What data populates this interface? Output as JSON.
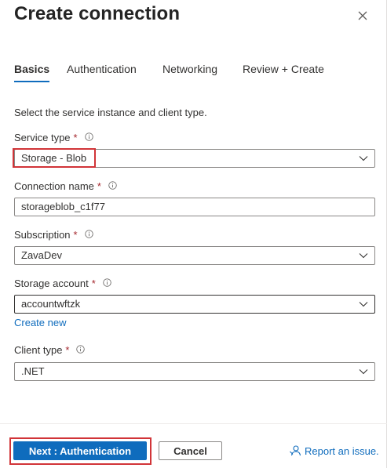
{
  "header": {
    "title": "Create connection"
  },
  "tabs": [
    {
      "label": "Basics",
      "active": true
    },
    {
      "label": "Authentication",
      "active": false
    },
    {
      "label": "Networking",
      "active": false
    },
    {
      "label": "Review + Create",
      "active": false
    }
  ],
  "intro": "Select the service instance and client type.",
  "form": {
    "service_type": {
      "label": "Service type",
      "required": "*",
      "value": "Storage - Blob"
    },
    "connection_name": {
      "label": "Connection name",
      "required": "*",
      "value": "storageblob_c1f77"
    },
    "subscription": {
      "label": "Subscription",
      "required": "*",
      "value": "ZavaDev"
    },
    "storage_account": {
      "label": "Storage account",
      "required": "*",
      "value": "accountwftzk",
      "create_new": "Create new"
    },
    "client_type": {
      "label": "Client type",
      "required": "*",
      "value": ".NET"
    }
  },
  "footer": {
    "next_label": "Next : Authentication",
    "cancel_label": "Cancel",
    "report_label": "Report an issue."
  },
  "colors": {
    "accent": "#0f6cbd",
    "required": "#a4262c",
    "highlight": "#d13438"
  }
}
